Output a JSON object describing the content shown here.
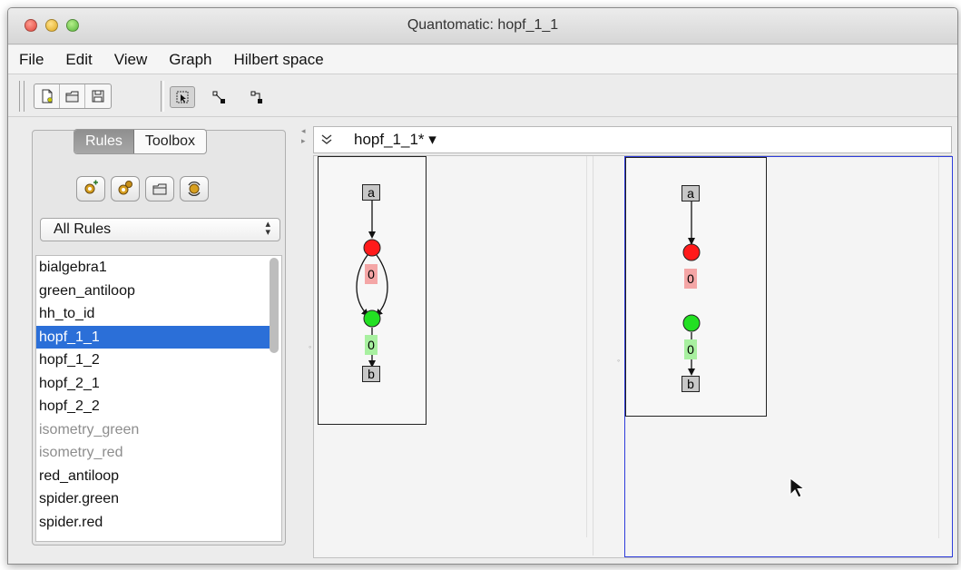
{
  "window": {
    "title": "Quantomatic: hopf_1_1"
  },
  "menu": {
    "items": [
      "File",
      "Edit",
      "View",
      "Graph",
      "Hilbert space"
    ]
  },
  "toolbar": {
    "buttons": [
      "new-document-icon",
      "open-folder-icon",
      "save-icon",
      "select-tool-icon",
      "add-vertex-icon",
      "add-edge-icon"
    ]
  },
  "left_panel": {
    "tabs": [
      "Rules",
      "Toolbox"
    ],
    "active_tab": "Rules",
    "rule_buttons": [
      "new-rule-icon",
      "edit-rule-icon",
      "open-rule-icon",
      "refresh-rules-icon"
    ],
    "ruleset_select": "All Rules",
    "rules": [
      {
        "label": "bialgebra1",
        "state": "normal"
      },
      {
        "label": "green_antiloop",
        "state": "normal"
      },
      {
        "label": "hh_to_id",
        "state": "normal"
      },
      {
        "label": "hopf_1_1",
        "state": "selected"
      },
      {
        "label": "hopf_1_2",
        "state": "normal"
      },
      {
        "label": "hopf_2_1",
        "state": "normal"
      },
      {
        "label": "hopf_2_2",
        "state": "normal"
      },
      {
        "label": "isometry_green",
        "state": "inactive"
      },
      {
        "label": "isometry_red",
        "state": "inactive"
      },
      {
        "label": "red_antiloop",
        "state": "normal"
      },
      {
        "label": "spider.green",
        "state": "normal"
      },
      {
        "label": "spider.red",
        "state": "normal"
      }
    ]
  },
  "editor": {
    "tab_label": "hopf_1_1* ▾",
    "lhs": {
      "boundary_top": "a",
      "boundary_bottom": "b",
      "red_vertex_angle": "0",
      "green_vertex_angle": "0"
    },
    "rhs": {
      "boundary_top": "a",
      "boundary_bottom": "b",
      "red_vertex_angle": "0",
      "green_vertex_angle": "0"
    },
    "colors": {
      "red_vertex": "#ff1a1a",
      "green_vertex": "#22e022",
      "red_label_bg": "#f4a6a6",
      "green_label_bg": "#a8f0a0",
      "selection_border": "#2e3cdb"
    }
  }
}
